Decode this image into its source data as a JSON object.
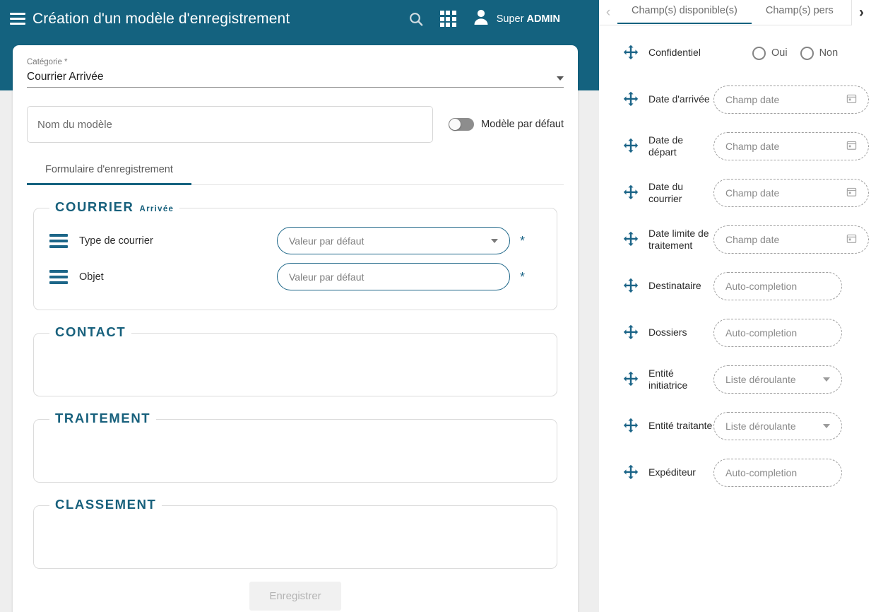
{
  "header": {
    "title": "Création d'un modèle d'enregistrement",
    "menu_icon": "hamburger-icon",
    "search_icon": "search-icon",
    "apps_icon": "grid-apps-icon",
    "avatar_icon": "user-avatar-icon",
    "user_first": "Super ",
    "user_role": "ADMIN",
    "bg_color": "#14627f"
  },
  "form": {
    "category_label": "Catégorie *",
    "category_value": "Courrier Arrivée",
    "name_placeholder": "Nom du modèle",
    "name_value": "",
    "toggle_label": "Modèle par défaut",
    "toggle_on": false,
    "tab_label": "Formulaire d'enregistrement",
    "save_label": "Enregistrer",
    "accent_color": "#17607c",
    "sections": [
      {
        "title": "COURRIER",
        "subtitle": "Arrivée",
        "fields": [
          {
            "label": "Type de courrier",
            "control": "select",
            "placeholder": "Valeur par défaut",
            "required": "*"
          },
          {
            "label": "Objet",
            "control": "text",
            "placeholder": "Valeur par défaut",
            "required": "*"
          }
        ]
      },
      {
        "title": "CONTACT",
        "subtitle": "",
        "fields": []
      },
      {
        "title": "TRAITEMENT",
        "subtitle": "",
        "fields": []
      },
      {
        "title": "CLASSEMENT",
        "subtitle": "",
        "fields": []
      }
    ]
  },
  "right_panel": {
    "prev_arrow": "‹",
    "next_arrow": "›",
    "tabs": [
      {
        "label": "Champ(s) disponible(s)",
        "active": true
      },
      {
        "label": "Champ(s) pers",
        "active": false
      }
    ],
    "fields": [
      {
        "label": "Confidentiel",
        "control": "radio",
        "options": [
          "Oui",
          "Non"
        ]
      },
      {
        "label": "Date d'arrivée",
        "control": "date",
        "placeholder": "Champ date"
      },
      {
        "label": "Date de départ",
        "control": "date",
        "placeholder": "Champ date"
      },
      {
        "label": "Date du courrier",
        "control": "date",
        "placeholder": "Champ date"
      },
      {
        "label": "Date limite de traitement",
        "control": "date",
        "placeholder": "Champ date"
      },
      {
        "label": "Destinataire",
        "control": "auto",
        "placeholder": "Auto-completion"
      },
      {
        "label": "Dossiers",
        "control": "auto",
        "placeholder": "Auto-completion"
      },
      {
        "label": "Entité initiatrice",
        "control": "list",
        "placeholder": "Liste déroulante"
      },
      {
        "label": "Entité traitante",
        "control": "list",
        "placeholder": "Liste déroulante"
      },
      {
        "label": "Expéditeur",
        "control": "auto",
        "placeholder": "Auto-completion"
      }
    ]
  }
}
